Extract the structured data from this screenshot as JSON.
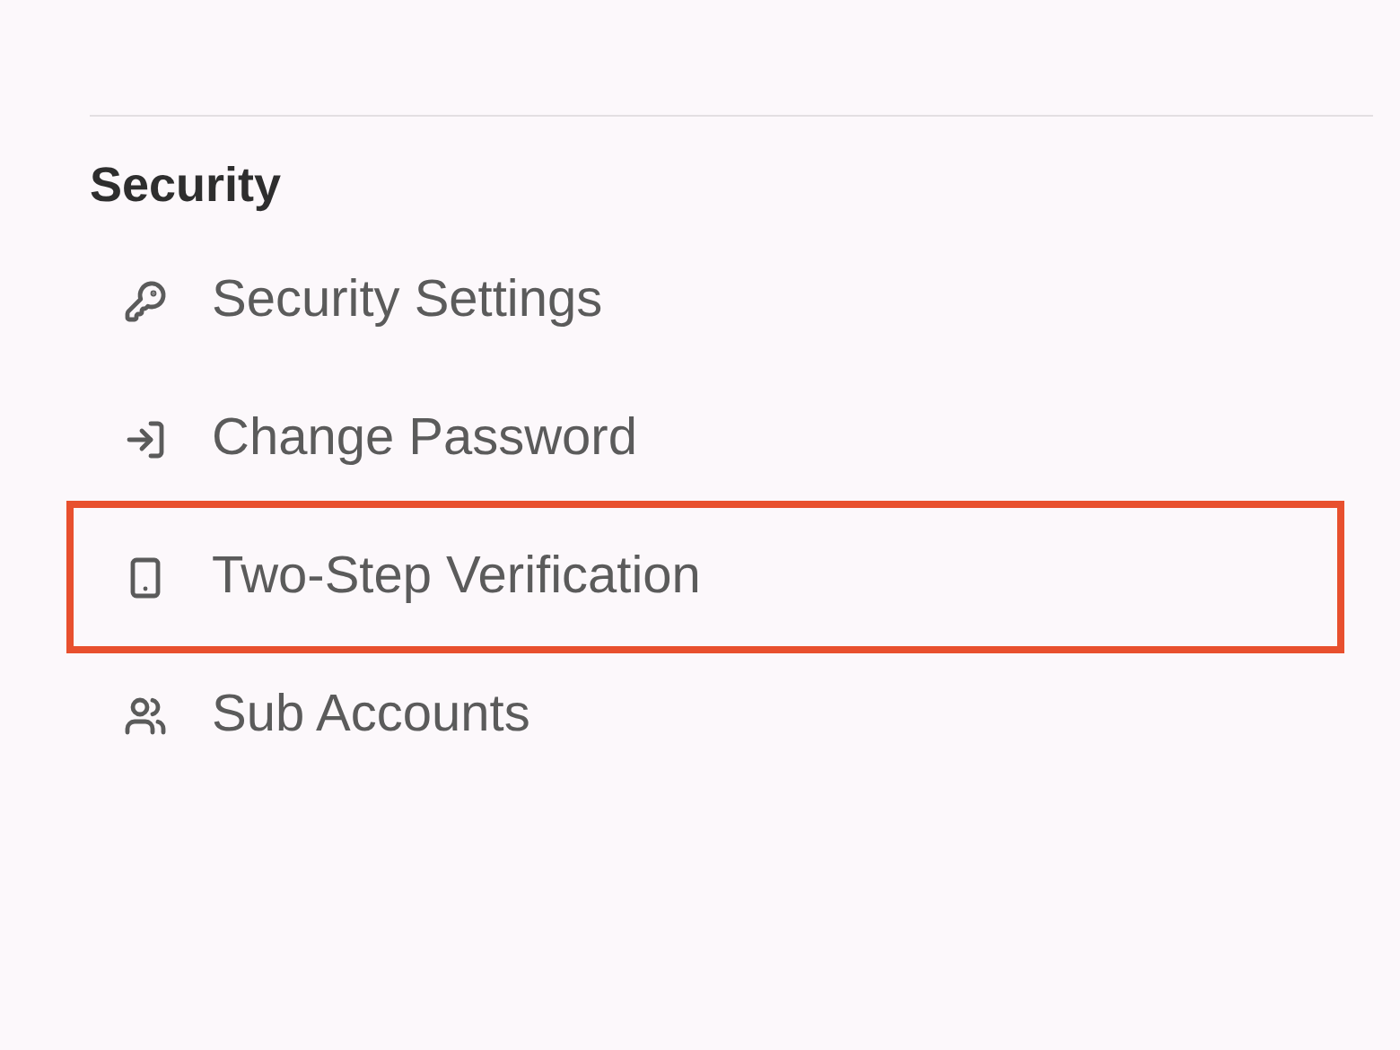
{
  "section": {
    "title": "Security"
  },
  "items": [
    {
      "label": "Security Settings",
      "highlighted": false
    },
    {
      "label": "Change Password",
      "highlighted": false
    },
    {
      "label": "Two-Step Verification",
      "highlighted": true
    },
    {
      "label": "Sub Accounts",
      "highlighted": false
    }
  ]
}
